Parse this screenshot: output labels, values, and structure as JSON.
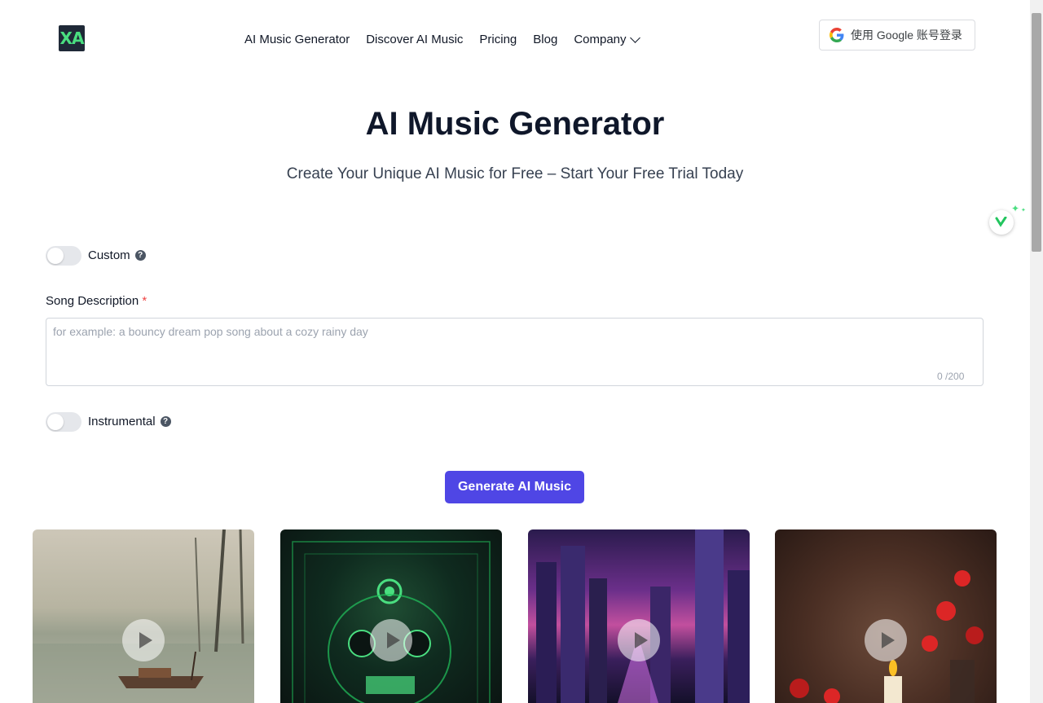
{
  "header": {
    "logo_text": "XA",
    "nav": [
      {
        "label": "AI Music Generator"
      },
      {
        "label": "Discover AI Music"
      },
      {
        "label": "Pricing"
      },
      {
        "label": "Blog"
      },
      {
        "label": "Company"
      }
    ],
    "google_login_label": "使用 Google 账号登录"
  },
  "hero": {
    "title": "AI Music Generator",
    "subtitle": "Create Your Unique AI Music for Free – Start Your Free Trial Today"
  },
  "form": {
    "custom_label": "Custom",
    "custom_on": false,
    "song_description_label": "Song Description",
    "required_mark": "*",
    "description_placeholder": "for example: a bouncy dream pop song about a cozy rainy day",
    "description_value": "",
    "char_counter": "0 /200",
    "instrumental_label": "Instrumental",
    "instrumental_on": false,
    "generate_label": "Generate AI Music"
  },
  "colors": {
    "accent": "#4f46e5",
    "logo_bg": "#1f2937",
    "logo_text": "#4ade80",
    "required": "#ef4444"
  },
  "cards": [
    {
      "icon": "play-icon"
    },
    {
      "icon": "play-icon"
    },
    {
      "icon": "play-icon"
    },
    {
      "icon": "play-icon"
    }
  ]
}
